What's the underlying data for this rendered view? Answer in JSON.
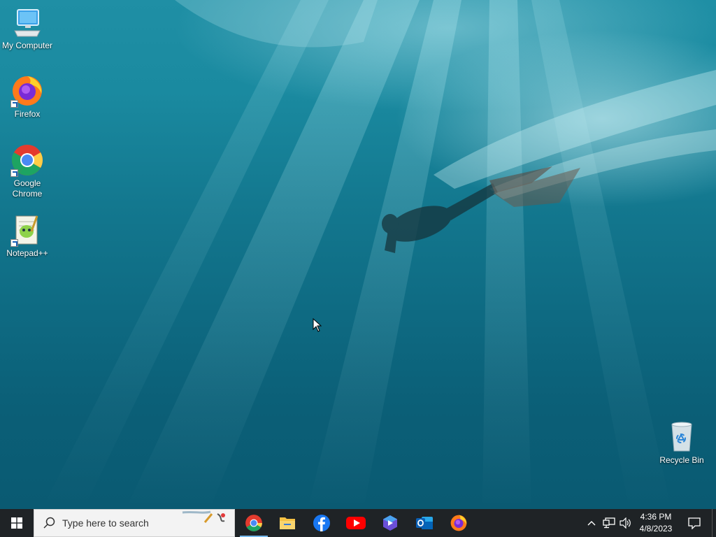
{
  "desktop": {
    "icons": [
      {
        "label": "My Computer",
        "icon": "computer-icon"
      },
      {
        "label": "Firefox",
        "icon": "firefox-icon"
      },
      {
        "label": "Google Chrome",
        "icon": "chrome-icon"
      },
      {
        "label": "Notepad++",
        "icon": "notepadpp-icon"
      },
      {
        "label": "Recycle Bin",
        "icon": "recycle-bin-icon"
      }
    ]
  },
  "taskbar": {
    "start_icon": "windows-logo-icon",
    "search": {
      "placeholder": "Type here to search"
    },
    "apps": [
      {
        "name": "Google Chrome",
        "icon": "chrome-icon",
        "active": true
      },
      {
        "name": "File Explorer",
        "icon": "folder-icon",
        "active": false
      },
      {
        "name": "Facebook",
        "icon": "facebook-icon",
        "active": false
      },
      {
        "name": "YouTube",
        "icon": "youtube-icon",
        "active": false
      },
      {
        "name": "Clipchamp",
        "icon": "clipchamp-icon",
        "active": false
      },
      {
        "name": "Outlook",
        "icon": "outlook-icon",
        "active": false
      },
      {
        "name": "Firefox",
        "icon": "firefox-icon",
        "active": false
      }
    ],
    "tray": {
      "icons": [
        "chevron-up-icon",
        "network-icon",
        "volume-icon"
      ],
      "time": "4:36 PM",
      "date": "4/8/2023",
      "notification_icon": "action-center-icon"
    }
  },
  "colors": {
    "taskbar_bg": "#1f2326",
    "active_indicator": "#76b9ed",
    "search_bg": "#f3f3f3"
  }
}
